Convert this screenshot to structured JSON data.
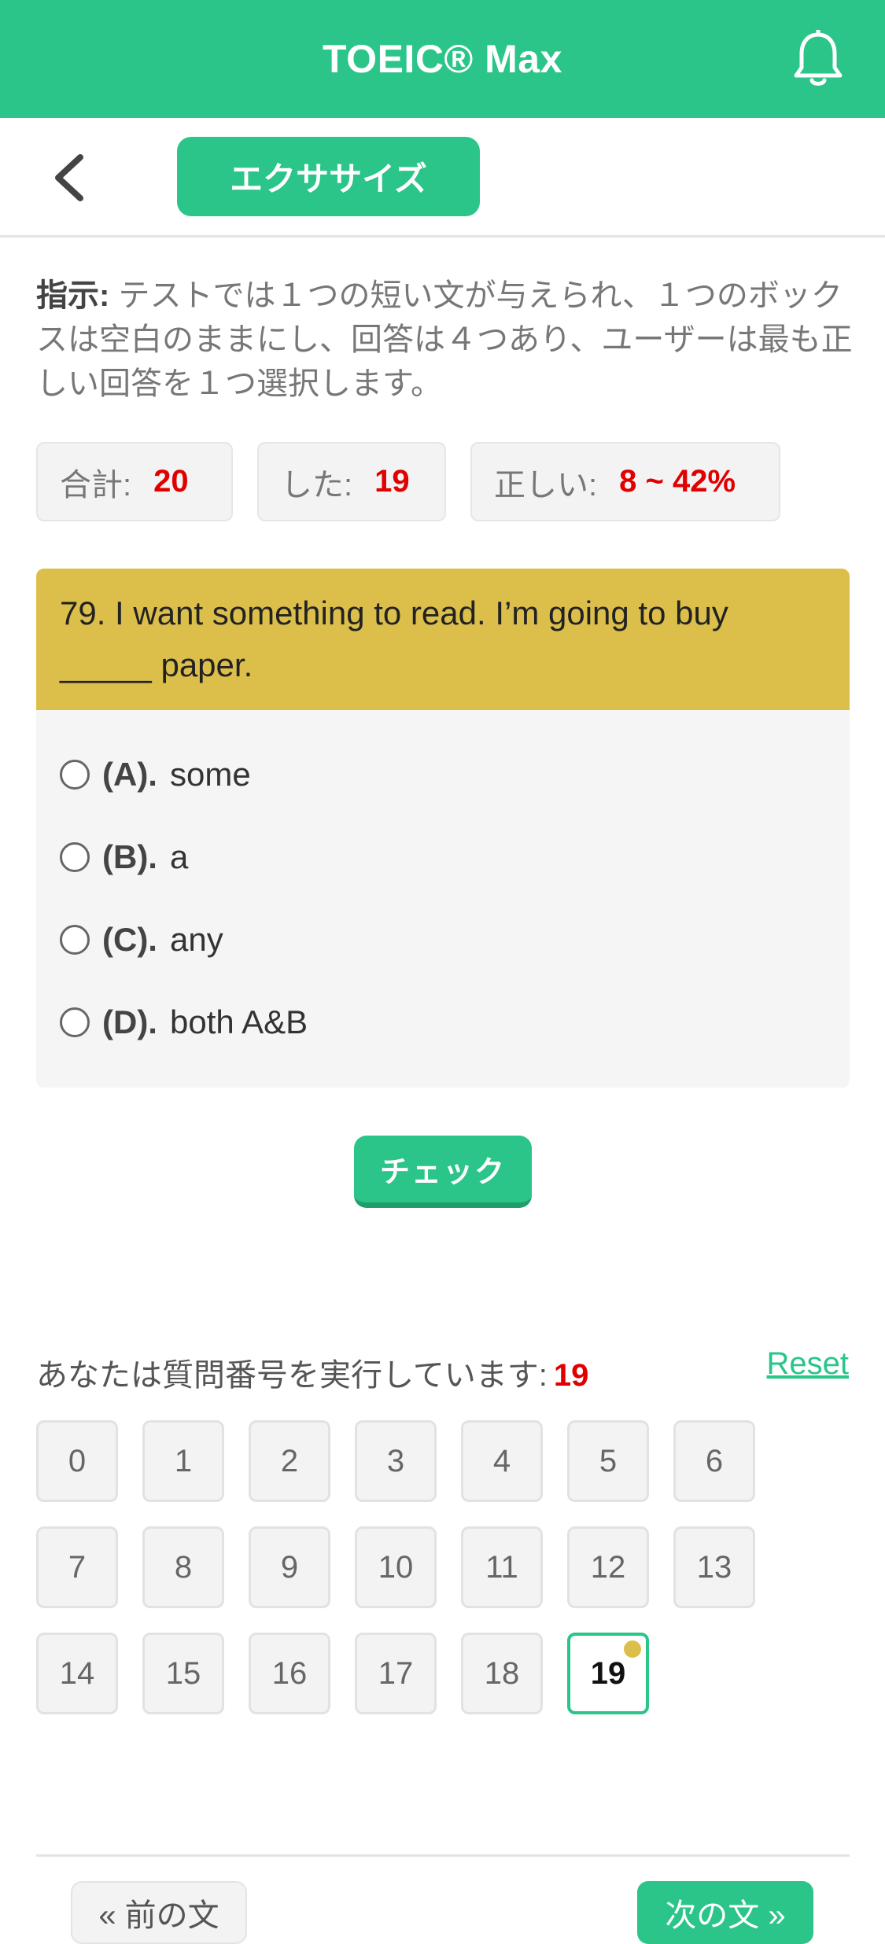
{
  "app": {
    "title": "TOEIC® Max"
  },
  "subheader": {
    "tab_label": "エクササイズ"
  },
  "instruction": {
    "lead": "指示:",
    "text": " テストでは１つの短い文が与えられ、１つのボックスは空白のままにし、回答は４つあり、ユーザーは最も正しい回答を１つ選択します。"
  },
  "stats": [
    {
      "label": "合計:",
      "value": "20"
    },
    {
      "label": "した:",
      "value": "19"
    },
    {
      "label": "正しい:",
      "value": "8 ~ 42%"
    }
  ],
  "question": {
    "text": "79. I want something to read. I’m going to buy _____ paper.",
    "options": [
      {
        "key": "(A).",
        "text": "some"
      },
      {
        "key": "(B).",
        "text": "a"
      },
      {
        "key": "(C).",
        "text": "any"
      },
      {
        "key": "(D).",
        "text": "both A&B"
      }
    ]
  },
  "check_label": "チェック",
  "progress": {
    "label": "あなたは質問番号を実行しています:",
    "current": "19",
    "reset_label": "Reset"
  },
  "question_numbers": [
    "0",
    "1",
    "2",
    "3",
    "4",
    "5",
    "6",
    "7",
    "8",
    "9",
    "10",
    "11",
    "12",
    "13",
    "14",
    "15",
    "16",
    "17",
    "18",
    "19"
  ],
  "footer": {
    "prev_label": "« 前の文",
    "next_label": "次の文 »"
  },
  "colors": {
    "brand": "#2bc589",
    "question_header": "#dcbf4b",
    "value_red": "#e00000"
  }
}
